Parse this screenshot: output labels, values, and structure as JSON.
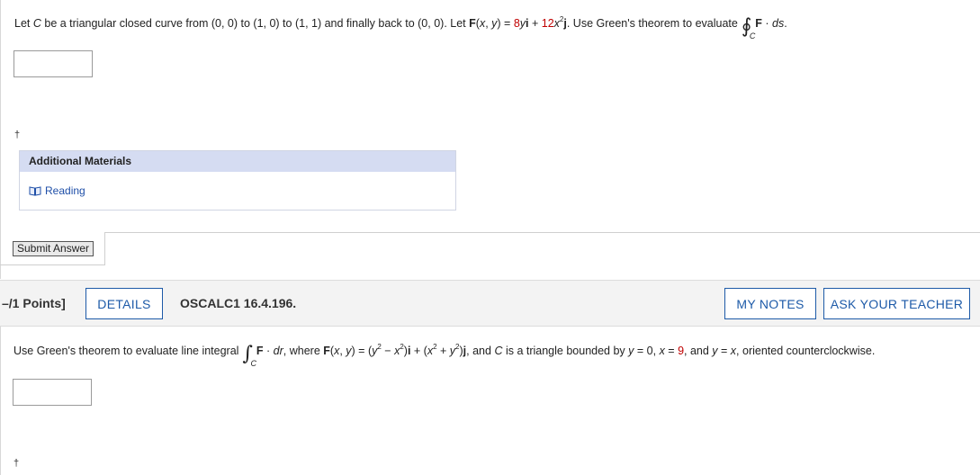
{
  "q1": {
    "text_a": "Let ",
    "c1": "C",
    "text_b": " be a triangular closed curve from (0, 0) to (1, 0) to (1, 1) and finally back to (0, 0). Let ",
    "F": "F",
    "text_c": "(",
    "x": "x",
    "comma": ", ",
    "y": "y",
    "text_d": ") = ",
    "coef1": "8",
    "y2": "y",
    "i": "i",
    "plus": " + ",
    "coef2": "12",
    "x2": "x",
    "exp": "2",
    "j": "j",
    "text_e": ". Use Green's theorem to evaluate",
    "integral_symbol": "∮",
    "integral_sub": "C",
    "F2": "F",
    "dot": " · ",
    "ds": "ds",
    "period": "."
  },
  "dagger": "†",
  "additional_materials": {
    "title": "Additional Materials",
    "link": "Reading",
    "link_icon": "book-icon"
  },
  "submit_label": "Submit Answer",
  "q2_header": {
    "points": "–/1 Points]",
    "details": "DETAILS",
    "problem_id": "OSCALC1 16.4.196.",
    "my_notes": "MY NOTES",
    "ask_teacher": "ASK YOUR TEACHER"
  },
  "q2": {
    "text_a": "Use Green's theorem to evaluate line integral",
    "integral_symbol": "∫",
    "integral_sub": "C",
    "F": "F",
    "dot": " · ",
    "dr": "dr",
    "text_b": ", where ",
    "F2": "F",
    "text_c": "(",
    "x": "x",
    "comma": ", ",
    "y": "y",
    "text_d": ") = (",
    "y2": "y",
    "e1": "2",
    "minus": " − ",
    "x2": "x",
    "e2": "2",
    "text_e": ")",
    "i": "i",
    "text_f": " + (",
    "x3": "x",
    "e3": "2",
    "plus": " + ",
    "y3": "y",
    "e4": "2",
    "text_g": ")",
    "j": "j",
    "text_h": ", and ",
    "c": "C",
    "text_i": " is a triangle bounded by ",
    "y4": "y",
    "text_j": " = 0, ",
    "x4": "x",
    "text_k": " = ",
    "nine": "9",
    "text_l": ", and ",
    "y5": "y",
    "text_m": " = ",
    "x5": "x",
    "text_n": ", oriented counterclockwise."
  },
  "colors": {
    "accent": "#1d5aa8",
    "number_red": "#c00000",
    "panel_header": "#d5dcf2"
  }
}
